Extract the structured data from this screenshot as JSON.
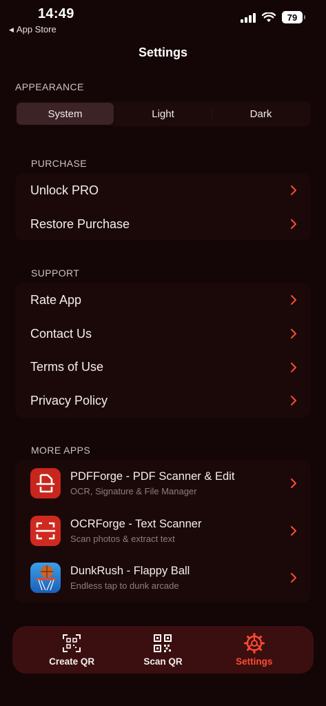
{
  "status_bar": {
    "time": "14:49",
    "back_label": "App Store",
    "battery": "79"
  },
  "page_title": "Settings",
  "appearance": {
    "label": "APPEARANCE",
    "options": [
      "System",
      "Light",
      "Dark"
    ],
    "selected": "System"
  },
  "purchase": {
    "label": "PURCHASE",
    "items": [
      "Unlock PRO",
      "Restore Purchase"
    ]
  },
  "support": {
    "label": "SUPPORT",
    "items": [
      "Rate App",
      "Contact Us",
      "Terms of Use",
      "Privacy Policy"
    ]
  },
  "more_apps": {
    "label": "MORE APPS",
    "apps": [
      {
        "name": "PDFForge - PDF Scanner & Edit",
        "desc": "OCR, Signature & File Manager",
        "icon": "pdf-document-icon"
      },
      {
        "name": "OCRForge - Text Scanner",
        "desc": "Scan photos & extract text",
        "icon": "scan-frame-icon"
      },
      {
        "name": "DunkRush - Flappy Ball",
        "desc": "Endless tap to dunk arcade",
        "icon": "basketball-hoop-icon"
      }
    ]
  },
  "tabbar": {
    "tabs": [
      {
        "label": "Create QR",
        "icon": "create-qr-icon"
      },
      {
        "label": "Scan QR",
        "icon": "qr-code-icon"
      },
      {
        "label": "Settings",
        "icon": "gear-icon"
      }
    ],
    "active": "Settings"
  },
  "colors": {
    "background": "#140506",
    "card": "#1b090a",
    "accent": "#ff4b31",
    "tabbar": "#3b0f10"
  }
}
